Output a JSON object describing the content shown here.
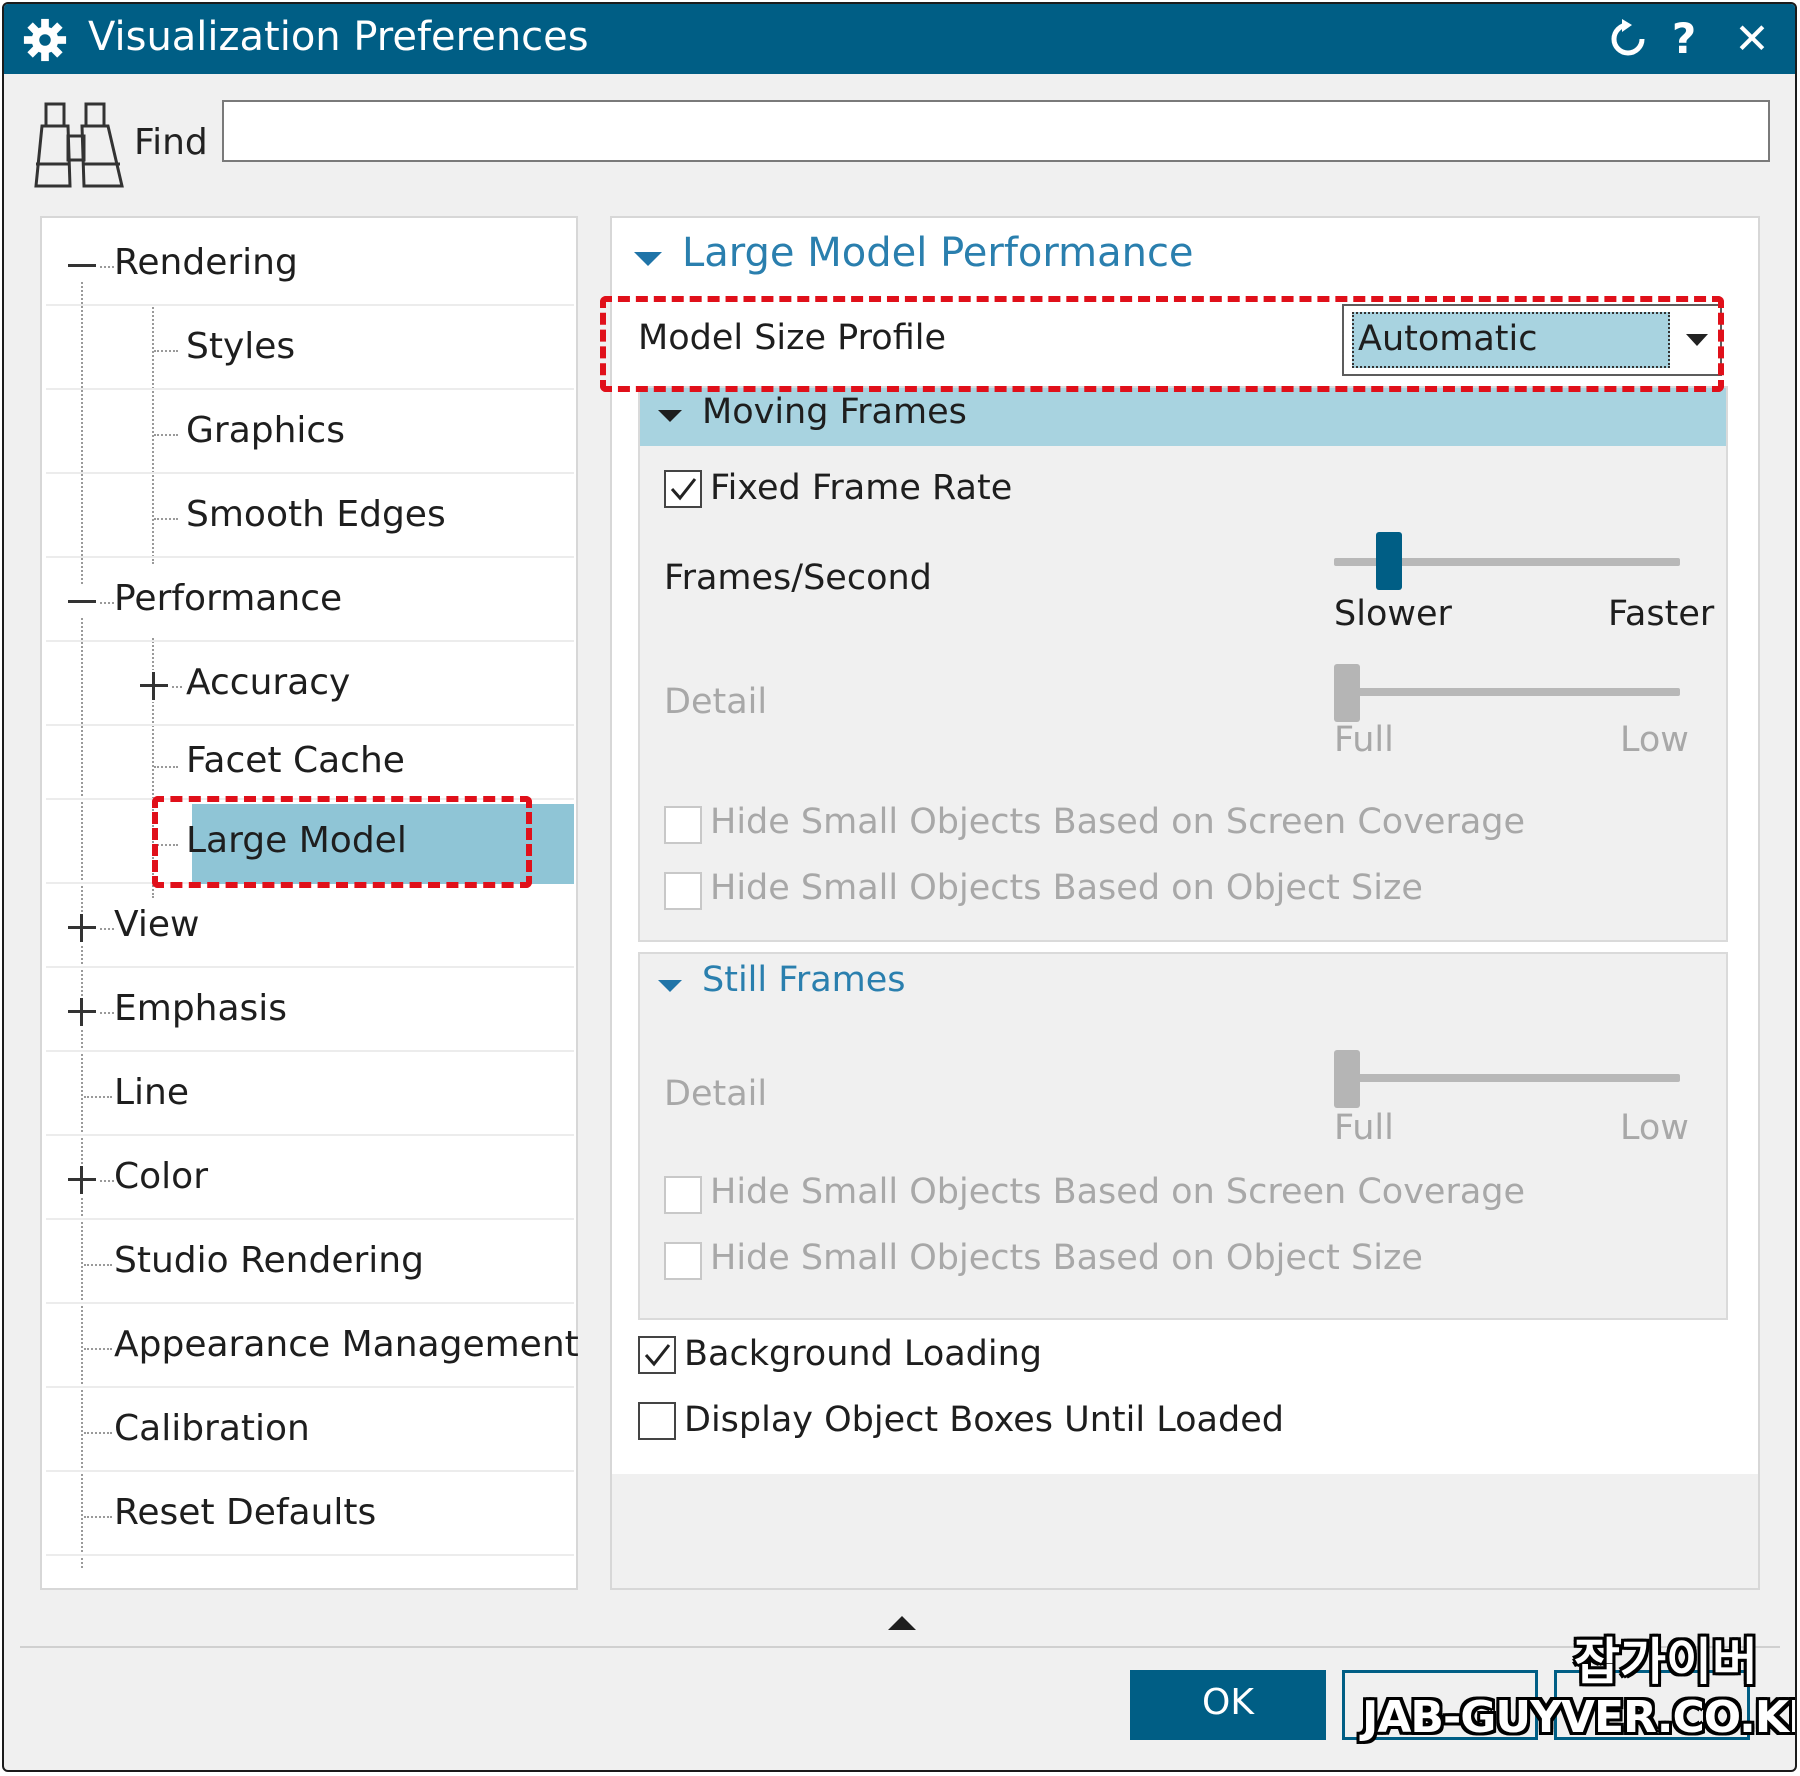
{
  "window": {
    "title": "Visualization Preferences",
    "title_bar_color": "#005e85",
    "controls": {
      "reset_icon": "refresh-icon",
      "help_label": "?",
      "close_label": "✕"
    }
  },
  "find": {
    "label": "Find",
    "value": "",
    "icon": "binoculars-icon"
  },
  "tree": {
    "items": [
      {
        "label": "Rendering"
      },
      {
        "label": "Styles"
      },
      {
        "label": "Graphics"
      },
      {
        "label": "Smooth Edges"
      },
      {
        "label": "Performance"
      },
      {
        "label": "Accuracy"
      },
      {
        "label": "Facet Cache"
      },
      {
        "label": "Large Model",
        "selected": true
      },
      {
        "label": "View"
      },
      {
        "label": "Emphasis"
      },
      {
        "label": "Line"
      },
      {
        "label": "Color"
      },
      {
        "label": "Studio Rendering"
      },
      {
        "label": "Appearance Management"
      },
      {
        "label": "Calibration"
      },
      {
        "label": "Reset Defaults"
      }
    ]
  },
  "panel": {
    "section_title": "Large Model Performance",
    "model_size_profile": {
      "label": "Model Size Profile",
      "value": "Automatic"
    },
    "moving_frames": {
      "title": "Moving Frames",
      "fixed_frame_rate": {
        "label": "Fixed Frame Rate",
        "checked": true
      },
      "frames_per_second": {
        "label": "Frames/Second",
        "min_label": "Slower",
        "max_label": "Faster",
        "level": 0.13
      },
      "detail": {
        "label": "Detail",
        "min_label": "Full",
        "max_label": "Low",
        "level": 0.0,
        "enabled": false
      },
      "hide_screen_coverage": {
        "label": "Hide Small Objects Based on Screen Coverage",
        "checked": false,
        "enabled": false
      },
      "hide_object_size": {
        "label": "Hide Small Objects Based on Object Size",
        "checked": false,
        "enabled": false
      }
    },
    "still_frames": {
      "title": "Still Frames",
      "detail": {
        "label": "Detail",
        "min_label": "Full",
        "max_label": "Low",
        "level": 0.0,
        "enabled": false
      },
      "hide_screen_coverage": {
        "label": "Hide Small Objects Based on Screen Coverage",
        "checked": false,
        "enabled": false
      },
      "hide_object_size": {
        "label": "Hide Small Objects Based on Object Size",
        "checked": false,
        "enabled": false
      }
    },
    "background_loading": {
      "label": "Background Loading",
      "checked": true
    },
    "display_object_boxes": {
      "label": "Display Object Boxes Until Loaded",
      "checked": false
    }
  },
  "footer": {
    "ok_label": "OK",
    "accent": "#005e85",
    "highlight": "#e0101a"
  },
  "watermark": {
    "line1": "잡가이버",
    "line2": "JAB-GUYVER.CO.KR"
  }
}
